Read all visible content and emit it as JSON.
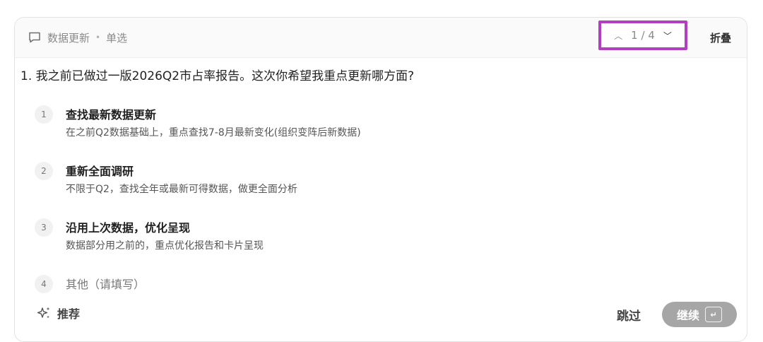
{
  "header": {
    "category": "数据更新",
    "separator": "•",
    "mode": "单选",
    "pager_text": "1 / 4",
    "fold_label": "折叠",
    "icons": {
      "chat": "chat-bubble-icon",
      "up": "chevron-up-icon",
      "down": "chevron-down-icon"
    }
  },
  "question": {
    "text": "1. 我之前已做过一版2026Q2市占率报告。这次你希望我重点更新哪方面?"
  },
  "options": [
    {
      "num": "1",
      "title": "查找最新数据更新",
      "desc": "在之前Q2数据基础上，重点查找7-8月最新变化(组织变阵后新数据)"
    },
    {
      "num": "2",
      "title": "重新全面调研",
      "desc": "不限于Q2，查找全年或最新可得数据，做更全面分析"
    },
    {
      "num": "3",
      "title": "沿用上次数据，优化呈现",
      "desc": "数据部分用之前的，重点优化报告和卡片呈现"
    },
    {
      "num": "4",
      "title": "其他（请填写）"
    }
  ],
  "footer": {
    "recommend_label": "推荐",
    "skip_label": "跳过",
    "continue_label": "继续",
    "enter_symbol": "↵"
  },
  "colors": {
    "highlight_border": "#b13fbf",
    "continue_bg": "#a6a6a6"
  }
}
